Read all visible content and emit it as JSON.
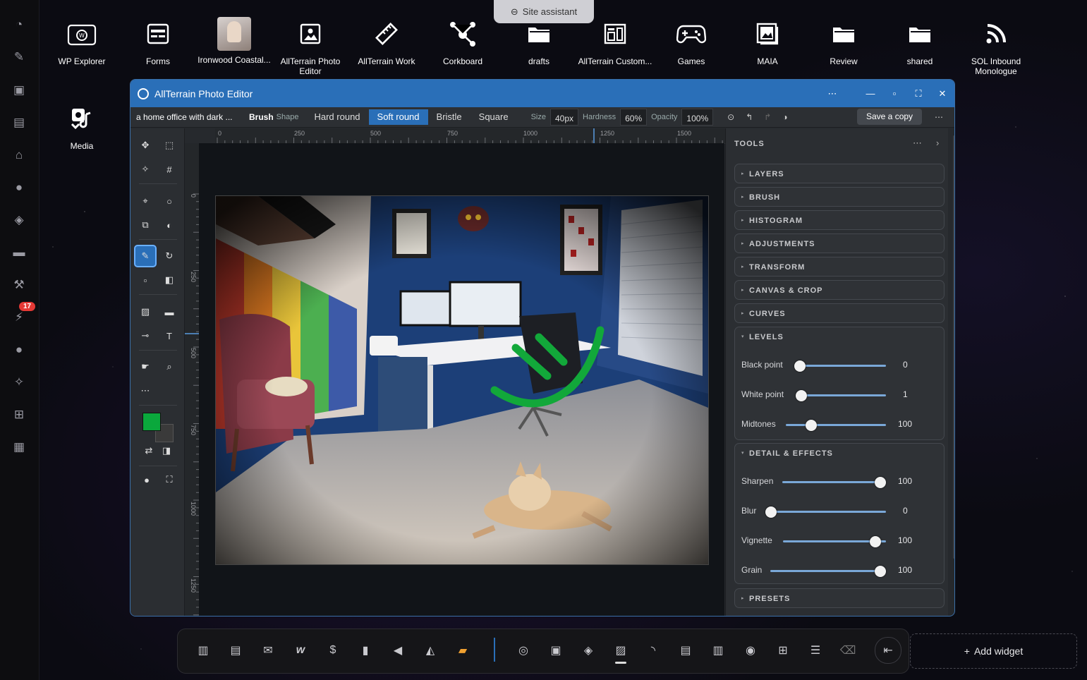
{
  "assistant": {
    "label": "Site assistant"
  },
  "desktop_icons": [
    {
      "label": "WP Explorer",
      "icon": "wordpress-folder-icon"
    },
    {
      "label": "Forms",
      "icon": "form-icon"
    },
    {
      "label": "Ironwood Coastal...",
      "icon": "photo-thumbnail"
    },
    {
      "label": "AllTerrain Photo Editor",
      "icon": "image-icon"
    },
    {
      "label": "AllTerrain Work",
      "icon": "ruler-icon"
    },
    {
      "label": "Corkboard",
      "icon": "network-icon"
    },
    {
      "label": "drafts",
      "icon": "folder-icon"
    },
    {
      "label": "AllTerrain Custom...",
      "icon": "layout-icon"
    },
    {
      "label": "Games",
      "icon": "gamepad-icon"
    },
    {
      "label": "MAIA",
      "icon": "image-stack-icon"
    },
    {
      "label": "Review",
      "icon": "folder-icon"
    },
    {
      "label": "shared",
      "icon": "folder-icon"
    },
    {
      "label": "SOL Inbound Monologue",
      "icon": "rss-icon"
    },
    {
      "label": "Media",
      "icon": "media-icon"
    }
  ],
  "left_dock": {
    "badge": "17"
  },
  "window": {
    "title": "AllTerrain Photo Editor",
    "more": "⋯"
  },
  "options": {
    "filename": "a home office with dark ...",
    "tool": "Brush",
    "shape_label": "Shape",
    "shapes": [
      "Hard round",
      "Soft round",
      "Bristle",
      "Square"
    ],
    "active_shape": "Soft round",
    "size_label": "Size",
    "size_value": "40px",
    "hardness_label": "Hardness",
    "hardness_value": "60%",
    "opacity_label": "Opacity",
    "opacity_value": "100%",
    "save_label": "Save a copy",
    "more": "⋯"
  },
  "rulers": {
    "h_ticks": [
      "0",
      "250",
      "500",
      "750",
      "1000",
      "1250",
      "1500"
    ],
    "v_ticks": [
      "0",
      "250",
      "500",
      "750",
      "1000",
      "1250"
    ]
  },
  "panel": {
    "title": "TOOLS",
    "more": "⋯",
    "collapse": "›",
    "sections_top": [
      "LAYERS",
      "BRUSH",
      "HISTOGRAM",
      "ADJUSTMENTS",
      "TRANSFORM",
      "CANVAS & CROP",
      "CURVES"
    ],
    "levels": {
      "title": "LEVELS",
      "rows": [
        {
          "label": "Black point",
          "value": "0",
          "fraction": 0.0
        },
        {
          "label": "White point",
          "value": "1",
          "fraction": 0.0
        },
        {
          "label": "Midtones",
          "value": "100",
          "fraction": 0.25
        }
      ]
    },
    "detail": {
      "title": "DETAIL & EFFECTS",
      "rows": [
        {
          "label": "Sharpen",
          "value": "100",
          "fraction": 1.0
        },
        {
          "label": "Blur",
          "value": "0",
          "fraction": 0.0
        },
        {
          "label": "Vignette",
          "value": "100",
          "fraction": 1.0
        },
        {
          "label": "Grain",
          "value": "100",
          "fraction": 1.0
        }
      ]
    },
    "presets": "PRESETS"
  },
  "colors": {
    "accent": "#2a6fb8",
    "primary_swatch": "#0aa83c",
    "secondary_swatch": "#3a3a3a"
  },
  "bottom_dock": {
    "add_widget": "Add widget"
  }
}
